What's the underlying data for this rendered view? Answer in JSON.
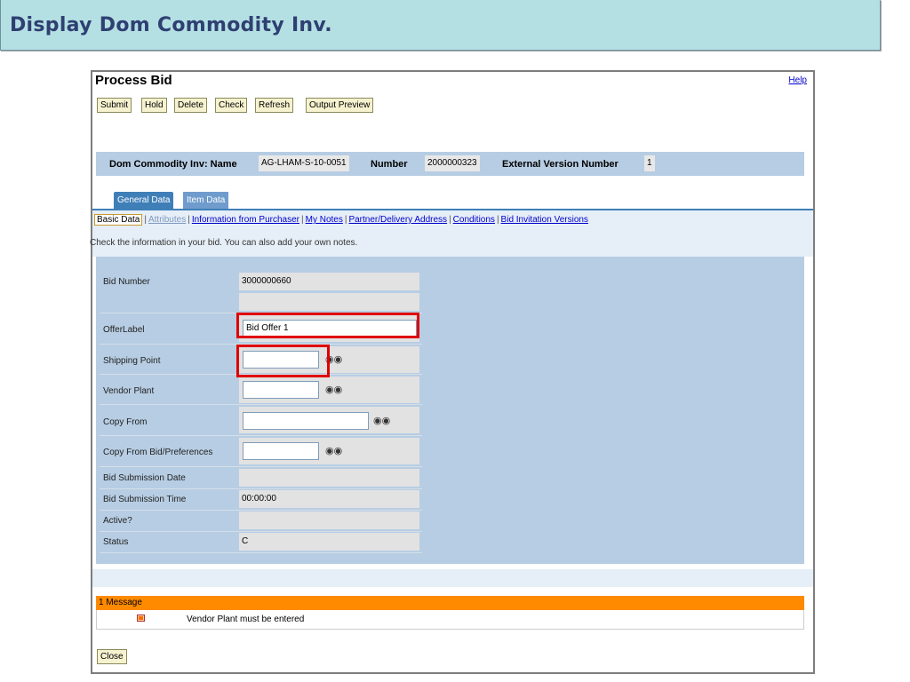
{
  "banner": {
    "title": "Display Dom Commodity Inv."
  },
  "window": {
    "title": "Process Bid",
    "help": "Help",
    "toolbar": {
      "submit": "Submit",
      "hold": "Hold",
      "delete": "Delete",
      "check": "Check",
      "refresh": "Refresh",
      "output_preview": "Output Preview"
    },
    "header": {
      "name_label": "Dom Commodity Inv: Name",
      "name_value": "AG-LHAM-S-10-0051",
      "number_label": "Number",
      "number_value": "2000000323",
      "ext_version_label": "External Version Number",
      "ext_version_value": "1"
    },
    "tabs": {
      "general": "General Data",
      "item": "Item Data"
    },
    "subnav": {
      "basic": "Basic Data",
      "attributes": "Attributes",
      "info_purchaser": "Information from Purchaser",
      "my_notes": "My Notes",
      "partner": "Partner/Delivery Address",
      "conditions": "Conditions",
      "bid_versions": "Bid Invitation Versions",
      "hint": "Check the information in your bid. You can also add your own notes."
    },
    "form": {
      "bid_number_label": "Bid Number",
      "bid_number_value": "3000000660",
      "offer_label_label": "OfferLabel",
      "offer_label_value": "Bid Offer 1",
      "shipping_point_label": "Shipping Point",
      "shipping_point_value": "",
      "vendor_plant_label": "Vendor Plant",
      "vendor_plant_value": "",
      "copy_from_label": "Copy From",
      "copy_from_value": "",
      "copy_from_bid_label": "Copy From Bid/Preferences",
      "copy_from_bid_value": "",
      "submission_date_label": "Bid Submission Date",
      "submission_date_value": "",
      "submission_time_label": "Bid Submission Time",
      "submission_time_value": "00:00:00",
      "active_label": "Active?",
      "active_value": "",
      "status_label": "Status",
      "status_value": "C"
    },
    "messages": {
      "header": "1 Message",
      "items": [
        "Vendor Plant must be entered"
      ]
    },
    "close": "Close"
  },
  "icons": {
    "binoculars": "binoculars-icon",
    "error": "error-icon"
  },
  "colors": {
    "banner": "#b4e0e3",
    "panel": "#b7cde3",
    "tab_active": "#3f7fb8",
    "message_bar": "#ff8a00",
    "highlight": "#e00000"
  }
}
